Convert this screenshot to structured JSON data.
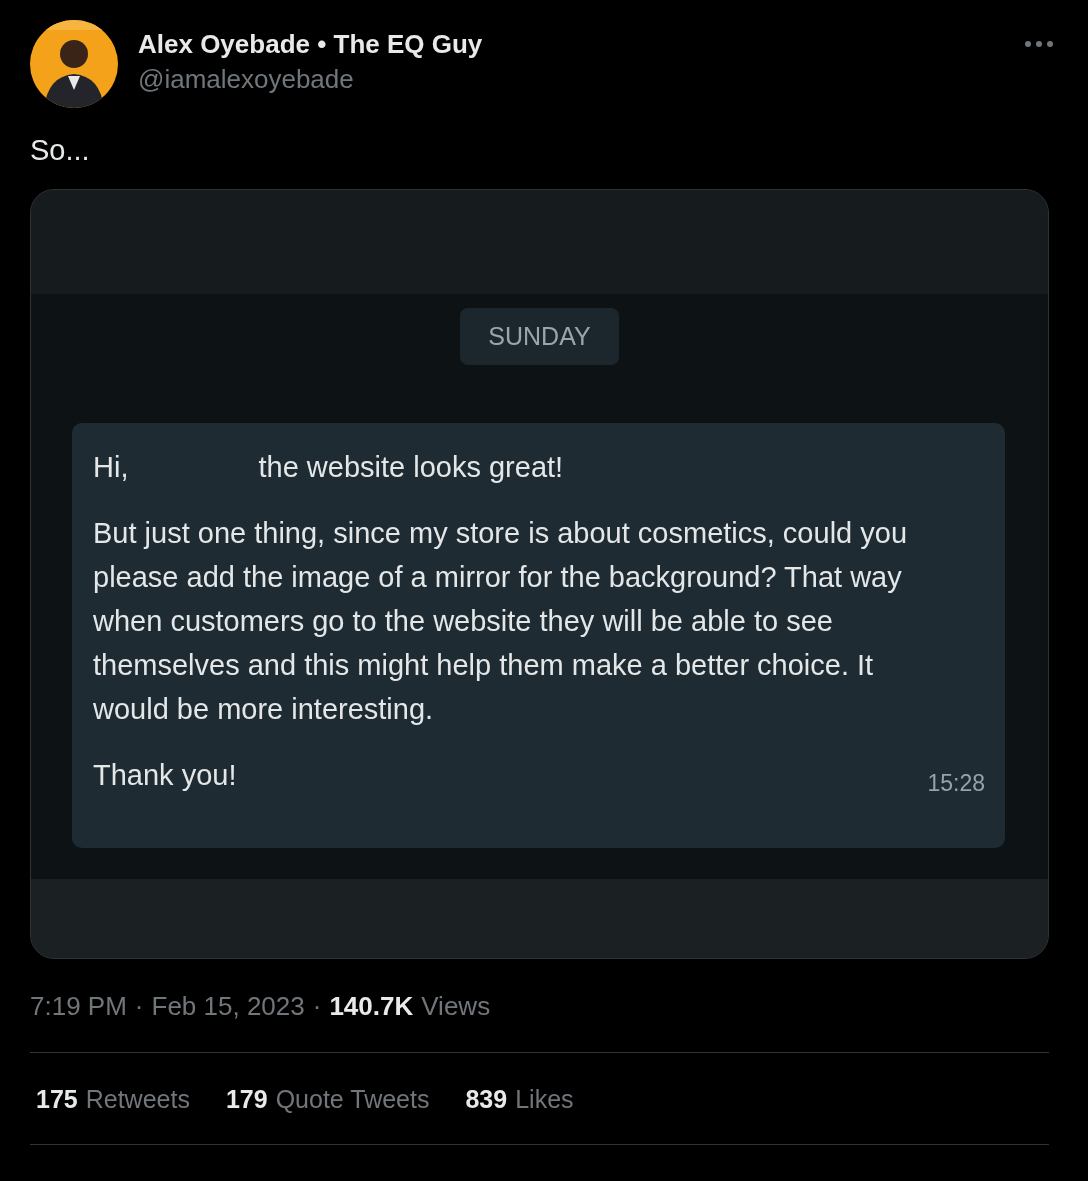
{
  "author": {
    "name": "Alex Oyebade • The EQ Guy",
    "handle": "@iamalexoyebade"
  },
  "tweet_text": "So...",
  "media": {
    "day_label": "SUNDAY",
    "message": {
      "greeting": [
        "Hi,",
        "the website looks great!"
      ],
      "body": "But just one thing, since my store is about cosmetics, could you please add the image of a mirror for the background? That way when customers go to the website they will be able to see themselves and this might help them make a better choice. It would be more interesting.",
      "closing": "Thank you!",
      "time": "15:28"
    }
  },
  "meta": {
    "time": "7:19 PM",
    "separator": "·",
    "date": "Feb 15, 2023",
    "separator_2": "·",
    "views_count": "140.7K",
    "views_label": "Views"
  },
  "stats": [
    {
      "count": "175",
      "label": "Retweets"
    },
    {
      "count": "179",
      "label": "Quote Tweets"
    },
    {
      "count": "839",
      "label": "Likes"
    }
  ]
}
